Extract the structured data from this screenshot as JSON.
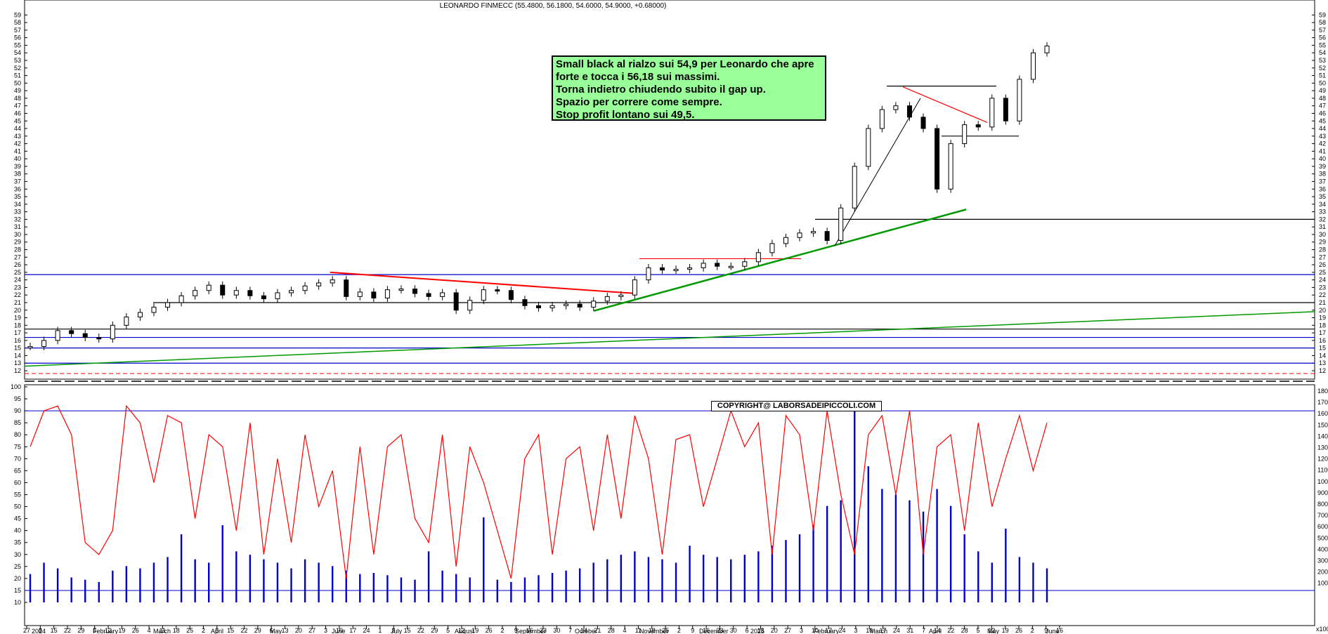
{
  "chart_data": {
    "type": "candlestick",
    "title": "LEONARDO FINMECC (55.4800, 56.1800, 54.6000, 54.9000, +0.68000)",
    "ylim": [
      12,
      60
    ],
    "price_ticks": [
      12,
      13,
      14,
      15,
      16,
      17,
      18,
      19,
      20,
      21,
      22,
      23,
      24,
      25,
      26,
      27,
      28,
      29,
      30,
      31,
      32,
      33,
      34,
      35,
      36,
      37,
      38,
      39,
      40,
      41,
      42,
      43,
      44,
      45,
      46,
      47,
      48,
      49,
      50,
      51,
      52,
      53,
      54,
      55,
      56,
      57,
      58,
      59
    ],
    "osc_ticks": [
      10,
      15,
      20,
      25,
      30,
      35,
      40,
      45,
      50,
      55,
      60,
      65,
      70,
      75,
      80,
      85,
      90,
      95,
      100
    ],
    "volume_ticks": [
      "18000",
      "17000",
      "16000",
      "15000",
      "14000",
      "13000",
      "12000",
      "11000",
      "10000",
      "9000",
      "8000",
      "7000",
      "6000",
      "5000",
      "4000",
      "3000",
      "2000",
      "1000"
    ],
    "volume_unit_label": "x1000",
    "x_labels": [
      "27",
      "8",
      "15",
      "22",
      "29",
      "5",
      "12",
      "19",
      "26",
      "4",
      "11",
      "18",
      "25",
      "2",
      "8",
      "15",
      "22",
      "29",
      "6",
      "13",
      "20",
      "27",
      "3",
      "10",
      "17",
      "24",
      "1",
      "8",
      "15",
      "22",
      "29",
      "5",
      "12",
      "19",
      "26",
      "2",
      "9",
      "16",
      "23",
      "30",
      "7",
      "14",
      "21",
      "28",
      "4",
      "11",
      "18",
      "25",
      "2",
      "9",
      "16",
      "23",
      "30",
      "6",
      "13",
      "20",
      "27",
      "3",
      "10",
      "17",
      "24",
      "3",
      "10",
      "17",
      "24",
      "31",
      "7",
      "14",
      "22",
      "28",
      "5",
      "12",
      "19",
      "26",
      "2",
      "9",
      "16"
    ],
    "month_labels": [
      "2024",
      "February",
      "March",
      "April",
      "May",
      "June",
      "July",
      "August",
      "September",
      "October",
      "November",
      "December",
      "2025",
      "February",
      "March",
      "April",
      "May",
      "June"
    ],
    "horizontal_levels": [
      {
        "price": 24.7,
        "color": "#0000cc"
      },
      {
        "price": 21.0,
        "color": "#000000"
      },
      {
        "price": 17.5,
        "color": "#000000"
      },
      {
        "price": 16.4,
        "color": "#0000cc"
      },
      {
        "price": 15.0,
        "color": "#0000cc"
      },
      {
        "price": 13.0,
        "color": "#0000cc"
      },
      {
        "price": 32.0,
        "color": "#000000"
      },
      {
        "price": 26.8,
        "color": "#ff0000"
      },
      {
        "price": 43.0,
        "color": "#000000"
      },
      {
        "price": 49.6,
        "color": "#000000"
      }
    ],
    "price_series": [
      [
        "2024-01-01",
        15.2
      ],
      [
        "2024-01-08",
        16.0
      ],
      [
        "2024-01-15",
        17.3
      ],
      [
        "2024-01-22",
        16.9
      ],
      [
        "2024-01-29",
        16.4
      ],
      [
        "2024-02-05",
        16.2
      ],
      [
        "2024-02-12",
        18.0
      ],
      [
        "2024-02-19",
        19.1
      ],
      [
        "2024-02-26",
        19.7
      ],
      [
        "2024-03-04",
        20.4
      ],
      [
        "2024-03-11",
        21.0
      ],
      [
        "2024-03-18",
        21.9
      ],
      [
        "2024-03-25",
        22.6
      ],
      [
        "2024-04-01",
        23.3
      ],
      [
        "2024-04-08",
        22.0
      ],
      [
        "2024-04-15",
        22.6
      ],
      [
        "2024-04-22",
        21.9
      ],
      [
        "2024-04-29",
        21.5
      ],
      [
        "2024-05-06",
        22.3
      ],
      [
        "2024-05-13",
        22.6
      ],
      [
        "2024-05-20",
        23.2
      ],
      [
        "2024-05-27",
        23.6
      ],
      [
        "2024-06-03",
        24.0
      ],
      [
        "2024-06-10",
        21.8
      ],
      [
        "2024-06-17",
        22.4
      ],
      [
        "2024-06-24",
        21.6
      ],
      [
        "2024-07-01",
        22.7
      ],
      [
        "2024-07-08",
        22.8
      ],
      [
        "2024-07-15",
        22.2
      ],
      [
        "2024-07-22",
        21.8
      ],
      [
        "2024-07-29",
        22.3
      ],
      [
        "2024-08-05",
        20.0
      ],
      [
        "2024-08-12",
        21.3
      ],
      [
        "2024-08-19",
        22.7
      ],
      [
        "2024-08-26",
        22.6
      ],
      [
        "2024-09-02",
        21.4
      ],
      [
        "2024-09-09",
        20.6
      ],
      [
        "2024-09-16",
        20.3
      ],
      [
        "2024-09-23",
        20.6
      ],
      [
        "2024-09-30",
        20.8
      ],
      [
        "2024-10-07",
        20.4
      ],
      [
        "2024-10-14",
        21.2
      ],
      [
        "2024-10-21",
        21.8
      ],
      [
        "2024-10-28",
        22.0
      ],
      [
        "2024-11-04",
        24.0
      ],
      [
        "2024-11-11",
        25.6
      ],
      [
        "2024-11-18",
        25.3
      ],
      [
        "2024-11-25",
        25.4
      ],
      [
        "2024-12-02",
        25.6
      ],
      [
        "2024-12-09",
        26.2
      ],
      [
        "2024-12-16",
        25.8
      ],
      [
        "2024-12-23",
        25.8
      ],
      [
        "2024-12-30",
        26.4
      ],
      [
        "2025-01-06",
        27.6
      ],
      [
        "2025-01-13",
        28.8
      ],
      [
        "2025-01-20",
        29.6
      ],
      [
        "2025-01-27",
        30.2
      ],
      [
        "2025-02-03",
        30.4
      ],
      [
        "2025-02-10",
        29.2
      ],
      [
        "2025-02-17",
        33.5
      ],
      [
        "2025-02-24",
        39.0
      ],
      [
        "2025-03-03",
        44.0
      ],
      [
        "2025-03-10",
        46.5
      ],
      [
        "2025-03-17",
        47.0
      ],
      [
        "2025-03-24",
        45.5
      ],
      [
        "2025-03-31",
        44.0
      ],
      [
        "2025-04-07",
        36.0
      ],
      [
        "2025-04-14",
        42.0
      ],
      [
        "2025-04-22",
        44.5
      ],
      [
        "2025-04-28",
        44.2
      ],
      [
        "2025-05-05",
        48.0
      ],
      [
        "2025-05-12",
        45.0
      ],
      [
        "2025-05-19",
        50.5
      ],
      [
        "2025-05-26",
        54.0
      ],
      [
        "2025-06-02",
        54.9
      ]
    ],
    "oscillator_series": [
      75,
      90,
      92,
      80,
      35,
      30,
      40,
      92,
      85,
      60,
      88,
      85,
      45,
      80,
      75,
      40,
      85,
      30,
      70,
      35,
      80,
      50,
      65,
      20,
      75,
      30,
      75,
      80,
      45,
      35,
      80,
      25,
      75,
      60,
      40,
      20,
      70,
      80,
      30,
      70,
      75,
      40,
      80,
      45,
      88,
      70,
      30,
      78,
      80,
      50,
      70,
      90,
      75,
      85,
      30,
      88,
      80,
      40,
      90,
      55,
      30,
      80,
      88,
      55,
      90,
      30,
      75,
      80,
      40,
      85,
      50,
      70,
      88,
      65,
      85
    ],
    "volume_series": [
      2500,
      3500,
      3000,
      2200,
      2000,
      1800,
      2800,
      3200,
      3000,
      3500,
      4000,
      6000,
      3800,
      3500,
      6800,
      4500,
      4200,
      3800,
      3500,
      3000,
      3800,
      3500,
      3200,
      2800,
      2500,
      2600,
      2400,
      2200,
      2000,
      4500,
      2800,
      2500,
      2200,
      7500,
      2000,
      1800,
      2200,
      2400,
      2600,
      2800,
      3000,
      3500,
      3800,
      4200,
      4500,
      4000,
      3800,
      3500,
      5000,
      4200,
      4000,
      3800,
      4200,
      4500,
      5000,
      5500,
      6000,
      6800,
      8500,
      9000,
      17000,
      12000,
      10000,
      9500,
      9000,
      8000,
      10000,
      8500,
      6000,
      4500,
      3500,
      6500,
      4000,
      3500,
      3000
    ],
    "oscillator_upper": 90,
    "oscillator_lower": 15
  },
  "annotation": {
    "lines": [
      "Small black al rialzo sui 54,9 per Leonardo che apre",
      "forte e tocca i 56,18 sui massimi.",
      "Torna indietro chiudendo subito il gap up.",
      "Spazio per correre come sempre.",
      "Stop profit lontano sui 49,5."
    ]
  },
  "copyright": "COPYRIGHT@ LABORSADEIPICCOLI.COM",
  "colors": {
    "price": "#000000",
    "oscillator": "#ff0000",
    "volume": "#0000cc",
    "support_green": "#009900",
    "resistance_red": "#ff0000",
    "level_blue": "#0000cc",
    "note_bg": "#99ff99"
  }
}
